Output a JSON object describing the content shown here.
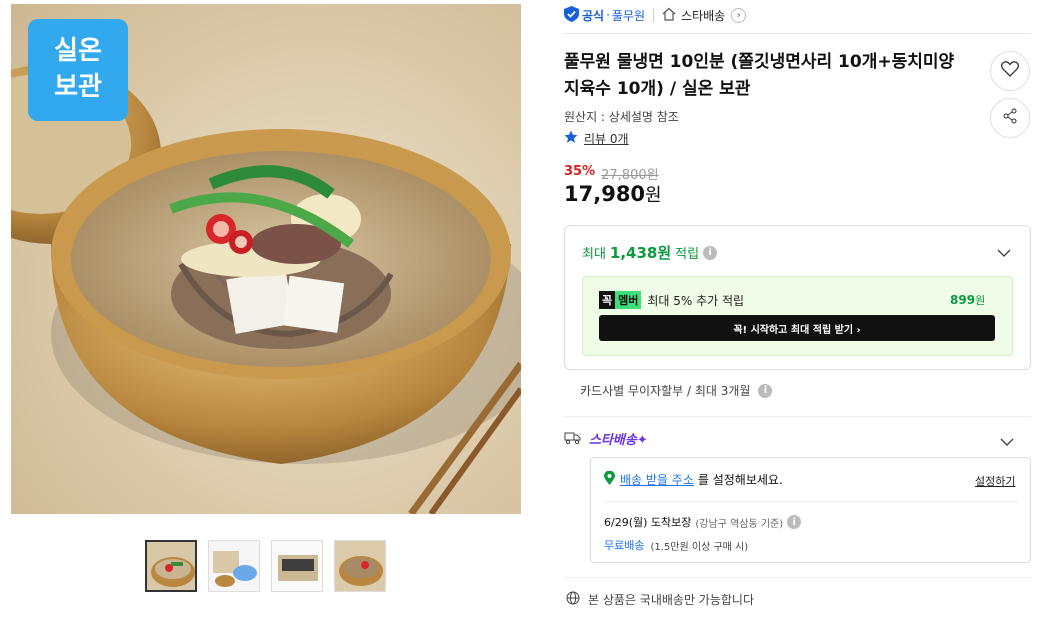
{
  "product_image": {
    "badge_line1": "실온",
    "badge_line2": "보관"
  },
  "seller": {
    "official_label": "공식",
    "dot": "·",
    "brand": "풀무원",
    "delivery_label": "스타배송"
  },
  "title_line1": "풀무원 물냉면 10인분 (쫄깃냉면사리 10개+동치미양",
  "title_line2": "지육수 10개) / 실온 보관",
  "origin": "원산지 : 상세설명 참조",
  "review": "리뷰 0개",
  "price": {
    "discount": "35%",
    "original": "27,800원",
    "sale_amount": "17,980",
    "sale_unit": "원"
  },
  "reward": {
    "prefix": "최대",
    "points": "1,438원",
    "suffix": "적립",
    "info": "i"
  },
  "member": {
    "badge_left": "꼭",
    "badge_right": "멤버",
    "text": "최대 5% 추가 적립",
    "amount": "899",
    "amount_unit": "원",
    "cta": "꼭! 시작하고 최대 적립 받기 ›"
  },
  "installment": "카드사별 무이자할부 / 최대 3개월",
  "star_delivery": {
    "logo": "스타배송"
  },
  "shipping": {
    "address_link": "배송 받을 주소",
    "address_rest": "를 설정해보세요.",
    "setup": "설정하기",
    "date": "6/29(월) 도착보장",
    "date_note": "(강남구 역삼동 기준)",
    "free": "무료배송",
    "free_note": "(1.5만원 이상 구매 시)"
  },
  "domestic": "본 상품은 국내배송만 가능합니다",
  "colors": {
    "red": "#e02020",
    "green": "#0a9a3d",
    "blue": "#1a73e8",
    "purple": "#6b33e6",
    "star_blue": "#1860d8"
  }
}
